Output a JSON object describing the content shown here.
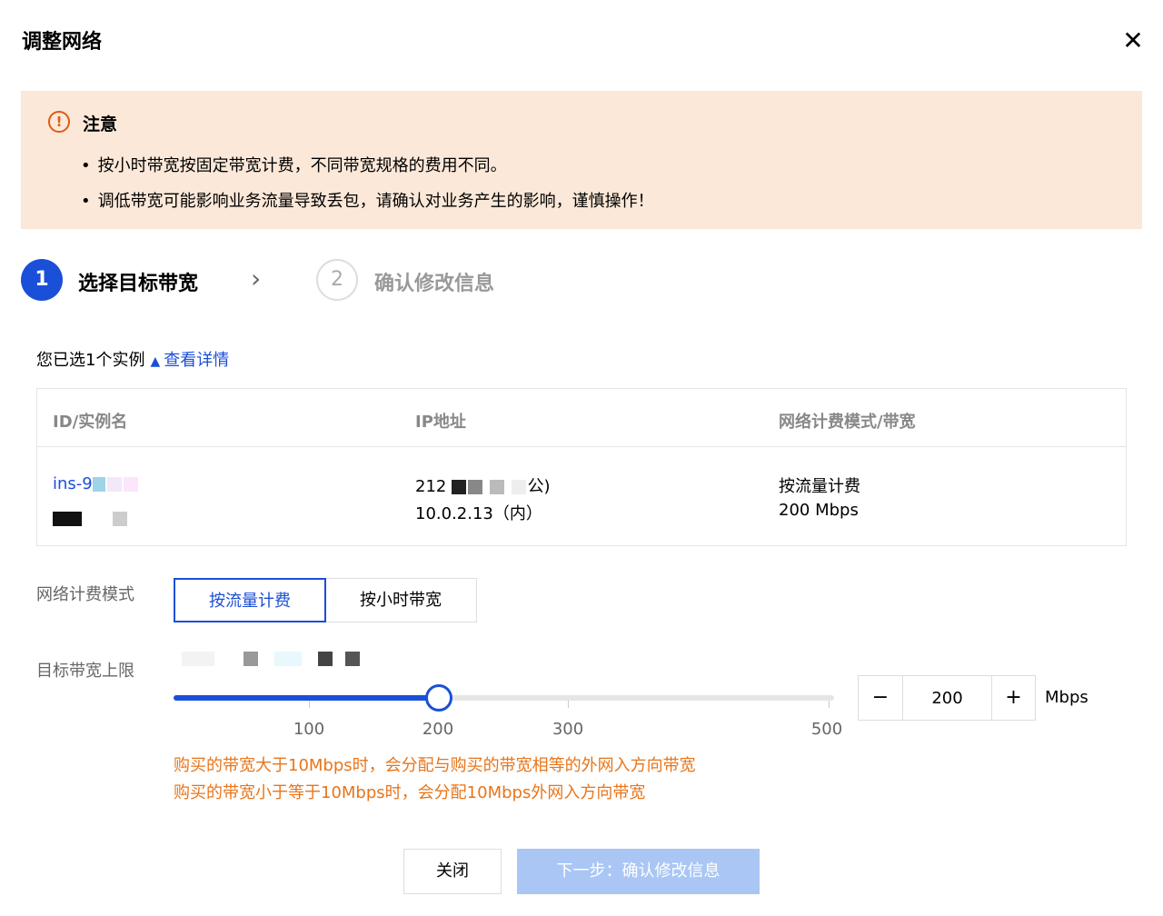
{
  "dialog": {
    "title": "调整网络",
    "close_label": "✕"
  },
  "notice": {
    "icon": "!",
    "title": "注意",
    "items": [
      "按小时带宽按固定带宽计费，不同带宽规格的费用不同。",
      "调低带宽可能影响业务流量导致丢包，请确认对业务产生的影响，谨慎操作！"
    ]
  },
  "steps": [
    {
      "number": "1",
      "label": "选择目标带宽",
      "state": "active"
    },
    {
      "number": "2",
      "label": "确认修改信息",
      "state": "inactive"
    }
  ],
  "selected": {
    "text": "您已选1个实例",
    "toggle_icon": "▲",
    "link": "查看详情"
  },
  "table": {
    "headers": [
      "ID/实例名",
      "IP地址",
      "网络计费模式/带宽"
    ],
    "rows": [
      {
        "id": "ins-9",
        "ip_public": "212",
        "ip_public_suffix": "公)",
        "ip_private": "10.0.2.13（内）",
        "billing_mode": "按流量计费",
        "bandwidth": "200 Mbps"
      }
    ]
  },
  "form": {
    "billing_mode_label": "网络计费模式",
    "billing_modes": [
      "按流量计费",
      "按小时带宽"
    ],
    "selected_mode": "按流量计费",
    "bandwidth_label": "目标带宽上限",
    "slider": {
      "value": 200,
      "ticks": [
        "100",
        "200",
        "300",
        "500"
      ]
    },
    "stepper": {
      "minus": "−",
      "value": "200",
      "plus": "+",
      "unit": "Mbps"
    },
    "hints": [
      "购买的带宽大于10Mbps时，会分配与购买的带宽相等的外网入方向带宽",
      "购买的带宽小于等于10Mbps时，会分配10Mbps外网入方向带宽"
    ]
  },
  "footer": {
    "close_label": "关闭",
    "next_label": "下一步：确认修改信息"
  },
  "colors": {
    "primary": "#1a4fd8",
    "warning_bg": "#fbe8d8",
    "warning_icon": "#e05a14",
    "hint_text": "#e8751a",
    "disabled_button": "#a9c6f5"
  }
}
